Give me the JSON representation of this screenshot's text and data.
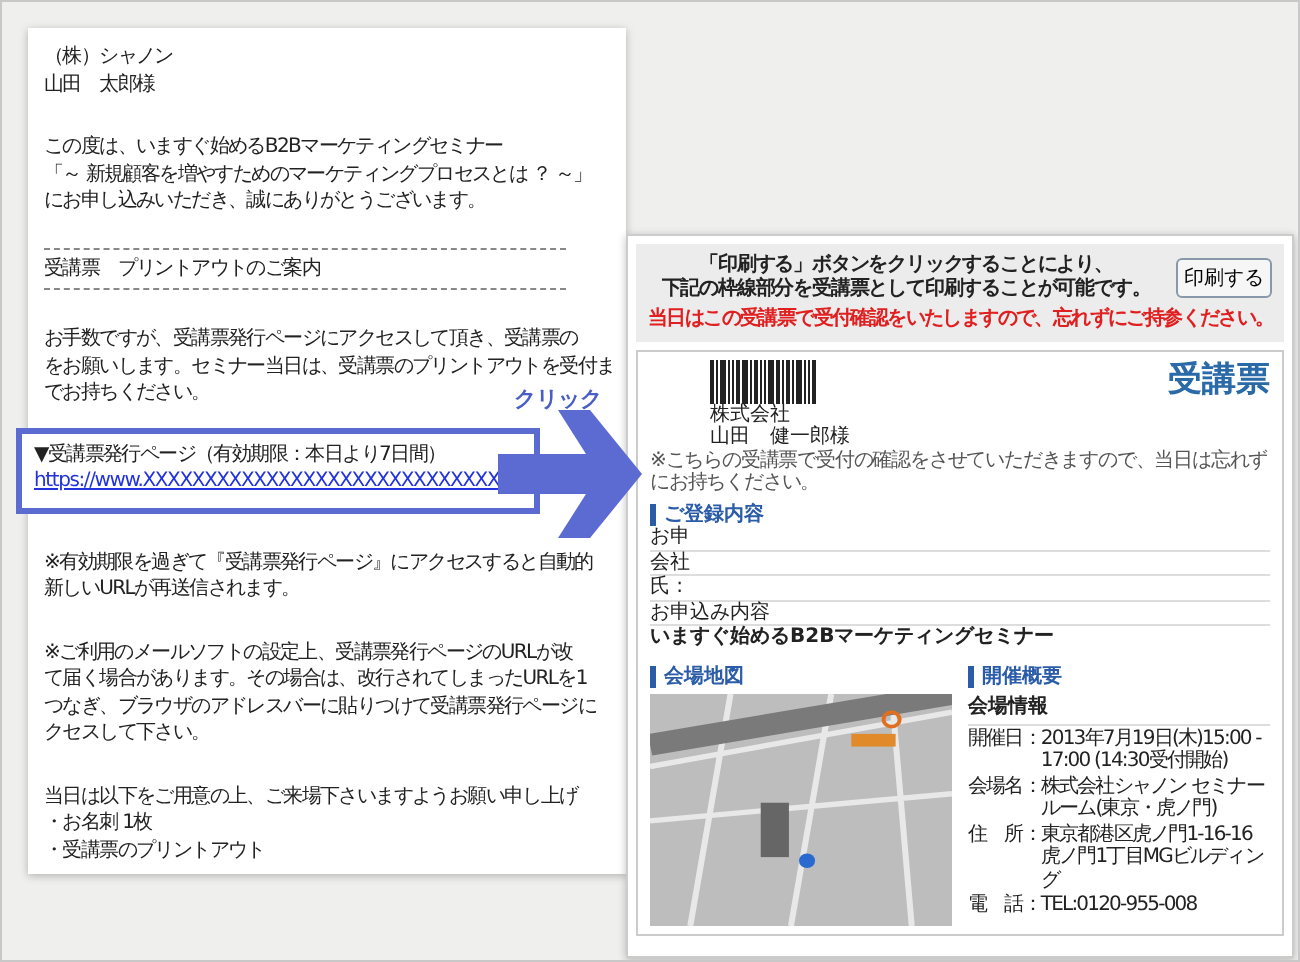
{
  "email": {
    "blocks": [
      {
        "kind": "text",
        "lines": [
          "（株）シャノン",
          "山田　太郎様"
        ]
      },
      {
        "kind": "text",
        "lines": [
          "この度は、いますぐ始めるB2Bマーケティングセミナー",
          "「～ 新規顧客を増やすためのマーケティングプロセスとは ？ ～」",
          "にお申し込みいただき、誠にありがとうございます。"
        ]
      },
      {
        "kind": "heading",
        "text": "受講票　プリントアウトのご案内"
      },
      {
        "kind": "text",
        "lines": [
          "お手数ですが、受講票発行ページにアクセスして頂き、受講票の",
          "をお願いします。セミナー当日は、受講票のプリントアウトを受付ま",
          "でお持ちください。"
        ]
      },
      {
        "kind": "link_box",
        "label": "▼受講票発行ページ（有効期限：本日より7日間）",
        "link": "https://www.XXXXXXXXXXXXXXXXXXXXXXXXXXXXX"
      },
      {
        "kind": "text",
        "lines": [
          "※有効期限を過ぎて『受講票発行ページ』にアクセスすると自動的",
          "新しいURLが再送信されます。"
        ]
      },
      {
        "kind": "text",
        "lines": [
          "※ご利用のメールソフトの設定上、受講票発行ページのURLが改",
          "て届く場合があります。その場合は、改行されてしまったURLを1",
          "つなぎ、ブラウザのアドレスバーに貼りつけて受講票発行ページに",
          "クセスして下さい。"
        ]
      },
      {
        "kind": "text",
        "lines": [
          "当日は以下をご用意の上、ご来場下さいますようお願い申し上げ",
          "・お名刺 1枚",
          "・受講票のプリントアウト"
        ]
      }
    ]
  },
  "click_label": "クリック",
  "ticket": {
    "notice_lines": [
      "「印刷する」ボタンをクリックすることにより、",
      "下記の枠線部分を受講票として印刷することが可能です。"
    ],
    "print_button": "印刷する",
    "warning": "当日はこの受講票で受付確認をいたしますので、忘れずにご持参ください。",
    "title": "受講票",
    "addressee": [
      "株式会社",
      "山田　健一郎様"
    ],
    "note": "※こちらの受講票で受付の確認をさせていただきますので、当日は忘れずにお持ちください。",
    "registration": {
      "heading": "ご登録内容",
      "rows": [
        "お申",
        "会社",
        "氏 :"
      ],
      "application_label": "お申込み内容",
      "seminar": "いますぐ始めるB2Bマーケティングセミナー"
    },
    "map_heading": "会場地図",
    "overview": {
      "heading": "開催概要",
      "subheading": "会場情報",
      "rows": [
        {
          "label": "開催日：",
          "value": "2013年7月19日(木)15:00 - 17:00 (14:30受付開始)"
        },
        {
          "label": "会場名：",
          "value": "株式会社シャノン セミナールーム(東京・虎ノ門)"
        },
        {
          "label": "住　所：",
          "value": "東京都港区虎ノ門1-16-16 虎ノ門1丁目MGビルディング"
        },
        {
          "label": "電　話：",
          "value": "TEL:0120-955-008"
        }
      ]
    }
  }
}
